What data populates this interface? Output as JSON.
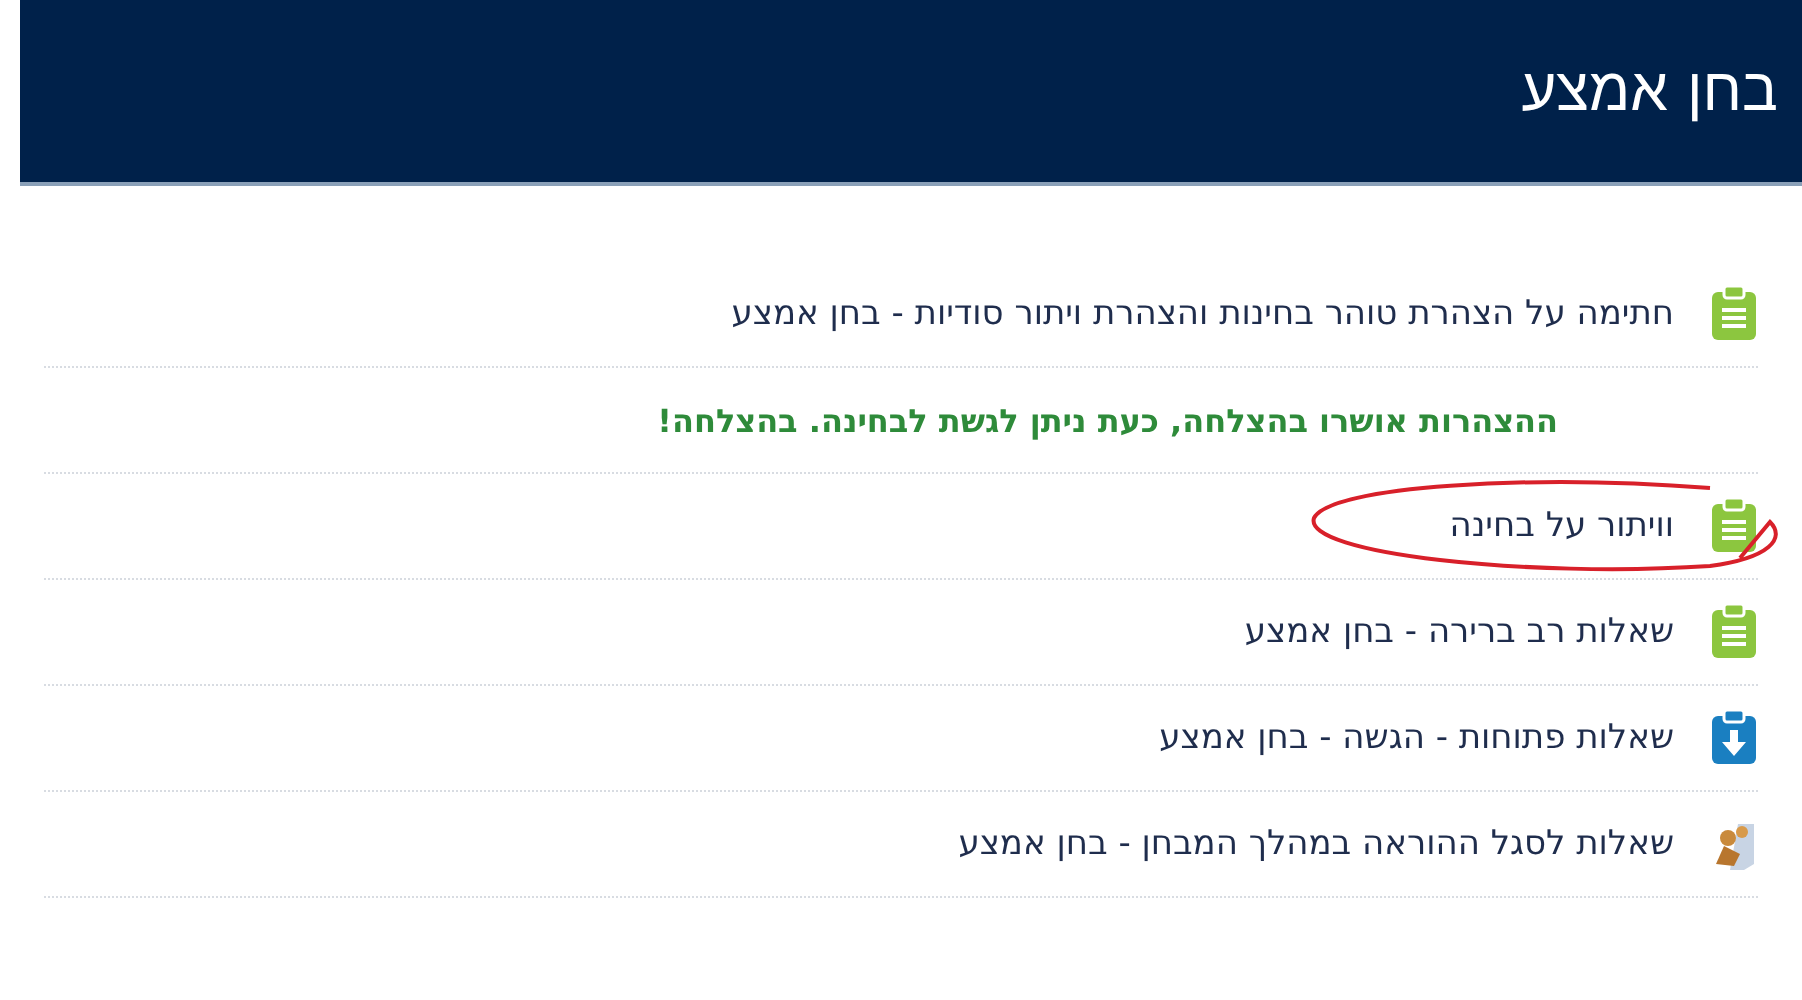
{
  "header": {
    "title": "בחן אמצע"
  },
  "items": [
    {
      "kind": "quiz",
      "text": "חתימה על הצהרת טוהר בחינות והצהרת ויתור סודיות - בחן אמצע",
      "circled": false
    },
    {
      "kind": "message",
      "text": "ההצהרות אושרו בהצלחה, כעת ניתן לגשת לבחינה. בהצלחה!"
    },
    {
      "kind": "quiz",
      "text": "וויתור על בחינה",
      "circled": true
    },
    {
      "kind": "quiz",
      "text": "שאלות רב ברירה - בחן אמצע",
      "circled": false
    },
    {
      "kind": "assign",
      "text": "שאלות פתוחות - הגשה - בחן אמצע",
      "circled": false
    },
    {
      "kind": "forum",
      "text": "שאלות לסגל ההוראה במהלך המבחן - בחן אמצע",
      "circled": false
    }
  ]
}
